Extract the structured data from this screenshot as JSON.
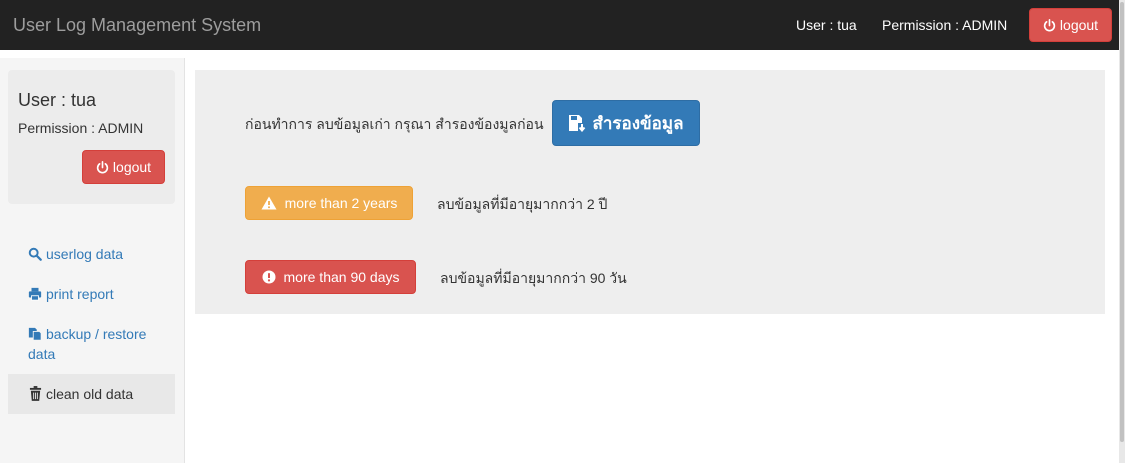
{
  "app": {
    "title": "User Log Management System",
    "user_label": "User : tua",
    "permission_label": "Permission : ADMIN",
    "logout_label": "logout"
  },
  "sidebar": {
    "user_label": "User : tua",
    "permission_label": "Permission : ADMIN",
    "logout_label": "logout",
    "items": [
      {
        "label": "userlog data",
        "icon": "search-icon"
      },
      {
        "label": "print report",
        "icon": "print-icon"
      },
      {
        "label": "backup / restore data",
        "icon": "copy-icon"
      },
      {
        "label": "clean old data",
        "icon": "trash-icon",
        "active": true
      }
    ]
  },
  "main": {
    "intro_text": "ก่อนทำการ ลบข้อมูลเก่า กรุณา สำรองข้องมูลก่อน",
    "backup_button": "สำรองข้อมูล",
    "options": [
      {
        "button": "more than 2 years",
        "description": "ลบข้อมูลที่มีอายุมากกว่า 2 ปี",
        "icon": "warning-icon",
        "color": "#f0ad4e"
      },
      {
        "button": "more than 90 days",
        "description": "ลบข้อมูลที่มีอายุมากกว่า 90 วัน",
        "icon": "exclamation-circle-icon",
        "color": "#d9534f"
      }
    ]
  },
  "colors": {
    "navbar": "#222222",
    "primary": "#337ab7",
    "danger": "#d9534f",
    "warning": "#f0ad4e",
    "link": "#337ab7"
  }
}
